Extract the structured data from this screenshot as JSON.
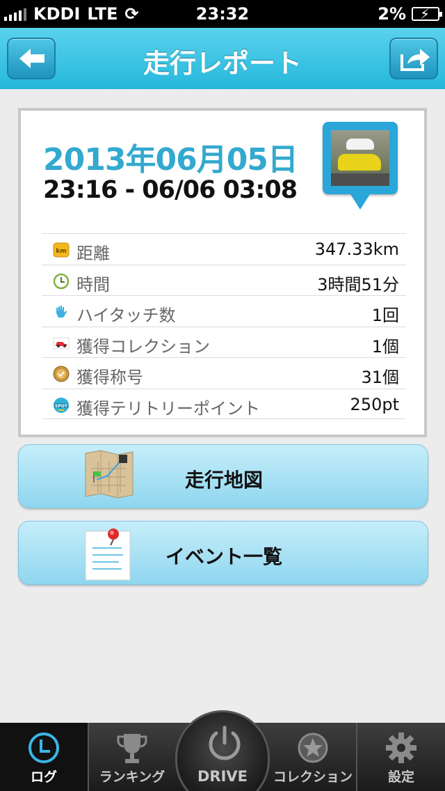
{
  "status_bar": {
    "carrier": "KDDI",
    "network": "LTE",
    "time": "23:32",
    "battery": "2%"
  },
  "nav": {
    "title": "走行レポート",
    "back_icon": "arrow-left-icon",
    "share_icon": "share-icon"
  },
  "report": {
    "date": "2013年06月05日",
    "time_range": "23:16 - 06/06 03:08",
    "stats": [
      {
        "icon": "km-icon",
        "label": "距離",
        "value": "347.33km"
      },
      {
        "icon": "clock-icon",
        "label": "時間",
        "value": "3時間51分"
      },
      {
        "icon": "hand-icon",
        "label": "ハイタッチ数",
        "value": "1回"
      },
      {
        "icon": "car-icon",
        "label": "獲得コレクション",
        "value": "1個"
      },
      {
        "icon": "medal-icon",
        "label": "獲得称号",
        "value": "31個"
      },
      {
        "icon": "spot-icon",
        "label": "獲得テリトリーポイント",
        "value": "250pt"
      }
    ]
  },
  "buttons": {
    "map": "走行地図",
    "events": "イベント一覧"
  },
  "tabbar": {
    "log": "ログ",
    "ranking": "ランキング",
    "drive": "DRIVE",
    "collection": "コレクション",
    "settings": "設定"
  },
  "colors": {
    "accent": "#33a9cf",
    "nav": "#25b7dc"
  }
}
